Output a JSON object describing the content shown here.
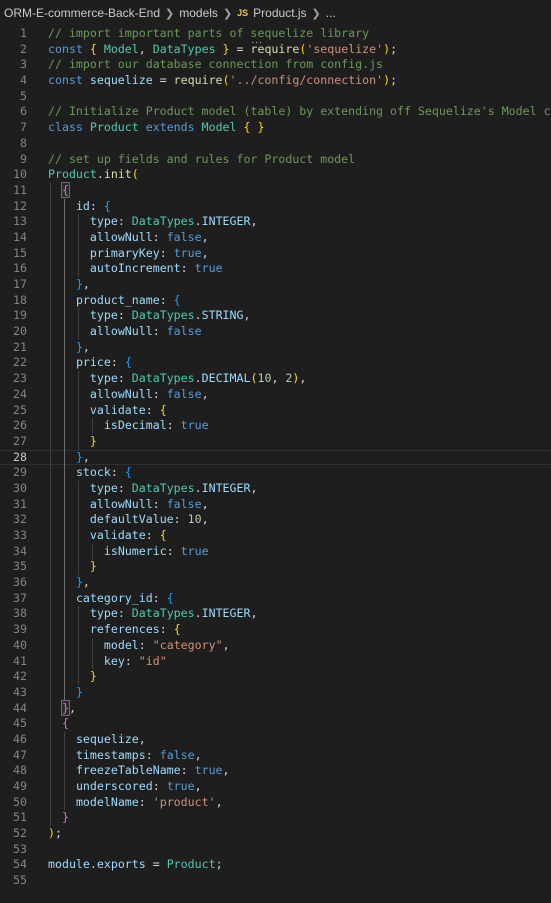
{
  "breadcrumb": {
    "folder": "ORM-E-commerce-Back-End",
    "subfolder": "models",
    "file_badge": "JS",
    "file": "Product.js",
    "ellipsis": "..."
  },
  "editor": {
    "language": "javascript",
    "current_line": 28,
    "colors": {
      "background": "#1e1e1e",
      "comment": "#6a9955",
      "keyword": "#569cd6",
      "string": "#ce9178",
      "number": "#b5cea8"
    },
    "lines": [
      "// import important parts of sequelize library",
      "const { Model, DataTypes } = require('sequelize');",
      "// import our database connection from config.js",
      "const sequelize = require('../config/connection');",
      "",
      "// Initialize Product model (table) by extending off Sequelize's Model class",
      "class Product extends Model { }",
      "",
      "// set up fields and rules for Product model",
      "Product.init(",
      "  {",
      "    id: {",
      "      type: DataTypes.INTEGER,",
      "      allowNull: false,",
      "      primaryKey: true,",
      "      autoIncrement: true",
      "    },",
      "    product_name: {",
      "      type: DataTypes.STRING,",
      "      allowNull: false",
      "    },",
      "    price: {",
      "      type: DataTypes.DECIMAL(10, 2),",
      "      allowNull: false,",
      "      validate: {",
      "        isDecimal: true",
      "      }",
      "    },",
      "    stock: {",
      "      type: DataTypes.INTEGER,",
      "      allowNull: false,",
      "      defaultValue: 10,",
      "      validate: {",
      "        isNumeric: true",
      "      }",
      "    },",
      "    category_id: {",
      "      type: DataTypes.INTEGER,",
      "      references: {",
      "        model: \"category\",",
      "        key: \"id\"",
      "      }",
      "    }",
      "  },",
      "  {",
      "    sequelize,",
      "    timestamps: false,",
      "    freezeTableName: true,",
      "    underscored: true,",
      "    modelName: 'product',",
      "  }",
      ");",
      "",
      "module.exports = Product;",
      ""
    ]
  }
}
